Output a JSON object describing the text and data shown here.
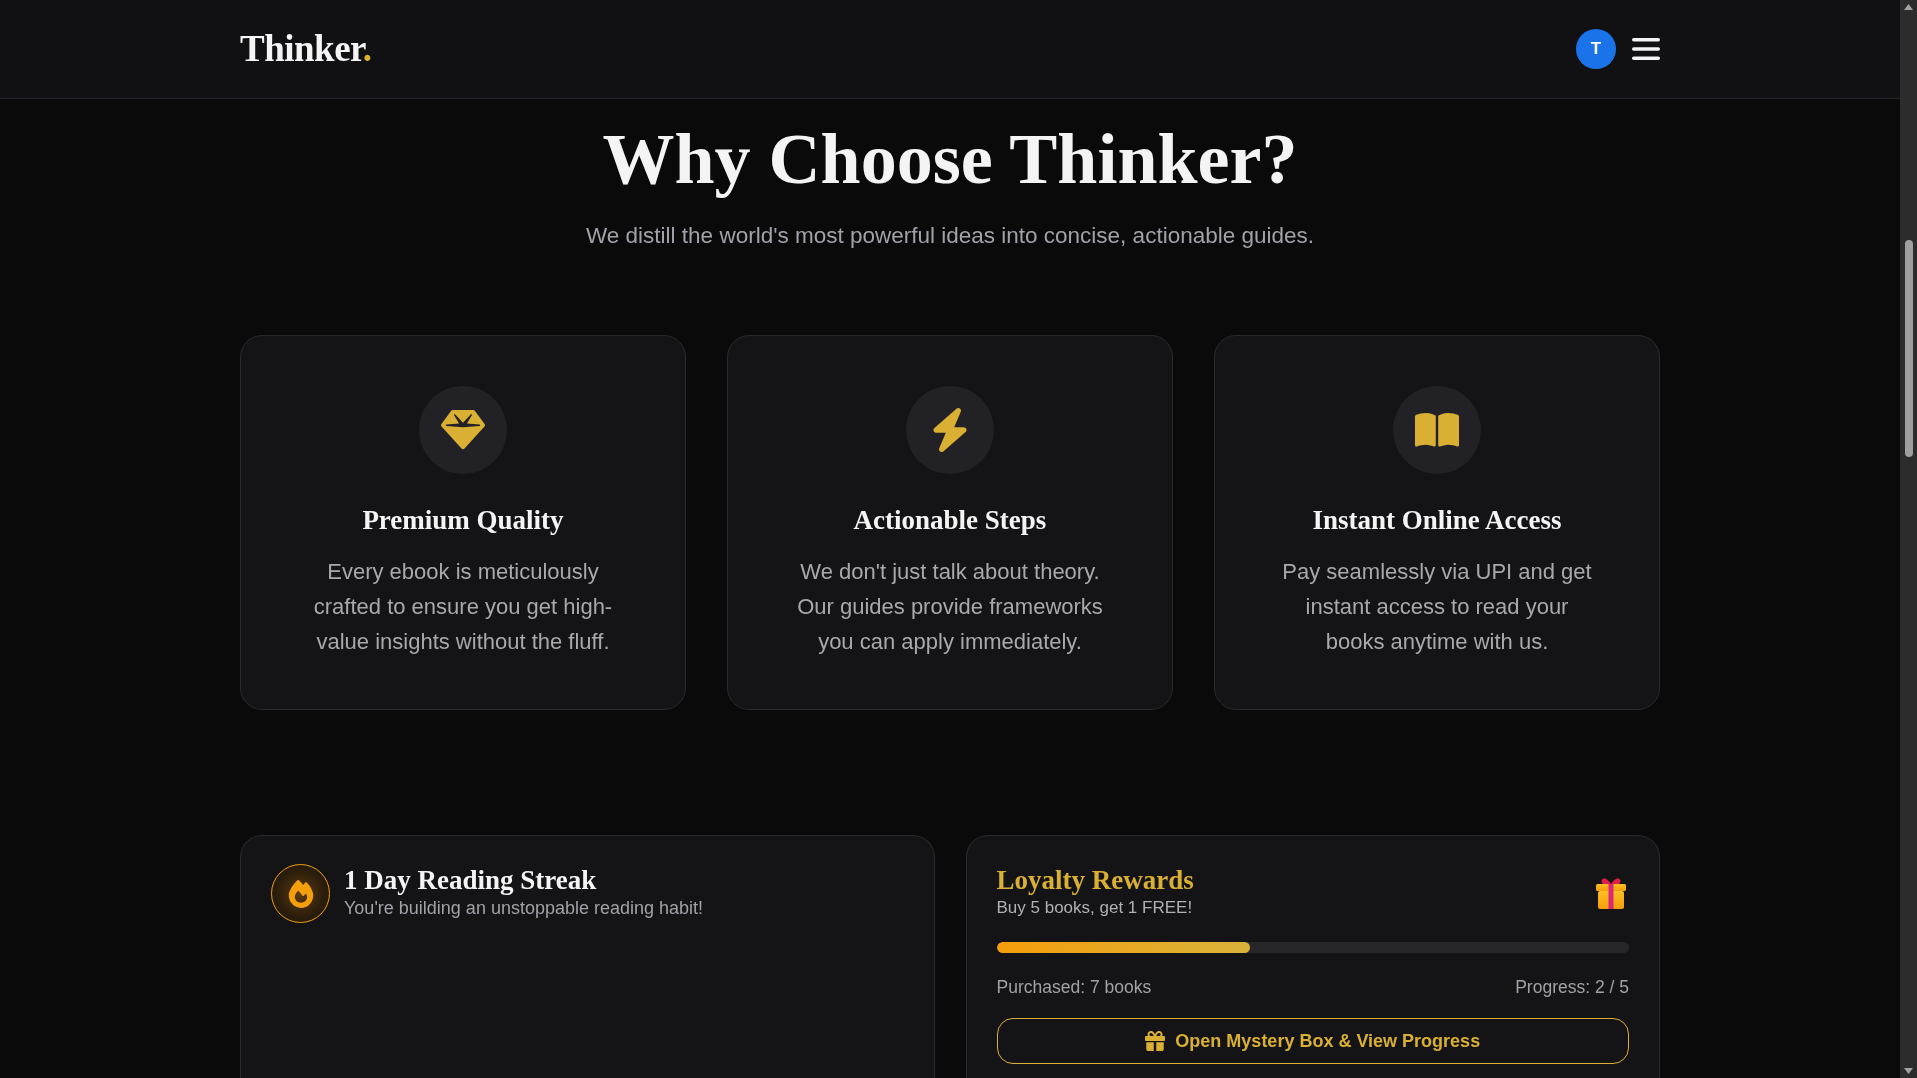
{
  "header": {
    "logo": {
      "text": "Thinker",
      "dot": "."
    },
    "avatar_initial": "T"
  },
  "hero": {
    "title": "Why Choose Thinker?",
    "subtitle": "We distill the world's most powerful ideas into concise, actionable guides."
  },
  "features": [
    {
      "title": "Premium Quality",
      "description": "Every ebook is meticulously crafted to ensure you get high-value insights without the fluff."
    },
    {
      "title": "Actionable Steps",
      "description": "We don't just talk about theory. Our guides provide frameworks you can apply immediately."
    },
    {
      "title": "Instant Online Access",
      "description": "Pay seamlessly via UPI and get instant access to read your books anytime with us."
    }
  ],
  "streak": {
    "title": "1 Day Reading Streak",
    "subtitle": "You're building an unstoppable reading habit!"
  },
  "loyalty": {
    "title": "Loyalty Rewards",
    "subtitle": "Buy 5 books, get 1 FREE!",
    "level": 0.4,
    "purchased": "Purchased: 7 books",
    "progress": "Progress: 2 / 5",
    "button": "Open Mystery Box & View Progress"
  }
}
